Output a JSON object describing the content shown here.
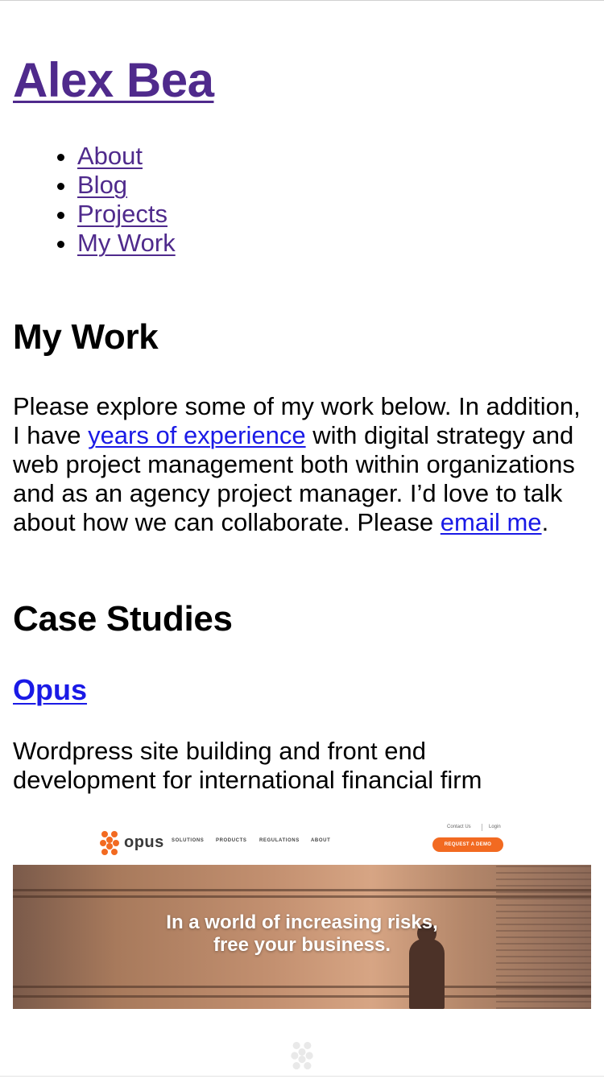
{
  "site": {
    "title": "Alex Bea"
  },
  "nav": {
    "items": [
      {
        "label": "About"
      },
      {
        "label": "Blog"
      },
      {
        "label": "Projects"
      },
      {
        "label": "My Work"
      }
    ]
  },
  "main": {
    "heading": "My Work",
    "intro": {
      "part1": "Please explore some of my work below. In addition, I have ",
      "link1": "years of experience",
      "part2": " with digital strategy and web project management both within organizations and as an agency project manager. I’d love to talk about how we can collaborate. Please ",
      "link2": "email me",
      "part3": "."
    },
    "case_studies_heading": "Case Studies",
    "case_studies": [
      {
        "title": "Opus",
        "description": "Wordpress site building and front end development for international financial firm",
        "screenshot": {
          "brand": "opus",
          "nav_items": [
            "SOLUTIONS",
            "PRODUCTS",
            "REGULATIONS",
            "ABOUT"
          ],
          "utility_links": [
            "Contact Us",
            "Login"
          ],
          "cta": "REQUEST A DEMO",
          "hero_line1": "In a world of increasing risks,",
          "hero_line2": "free your business."
        }
      }
    ]
  },
  "colors": {
    "visited_link": "#4f2a8c",
    "link": "#1a1ae6",
    "opus_orange": "#f26a21"
  }
}
